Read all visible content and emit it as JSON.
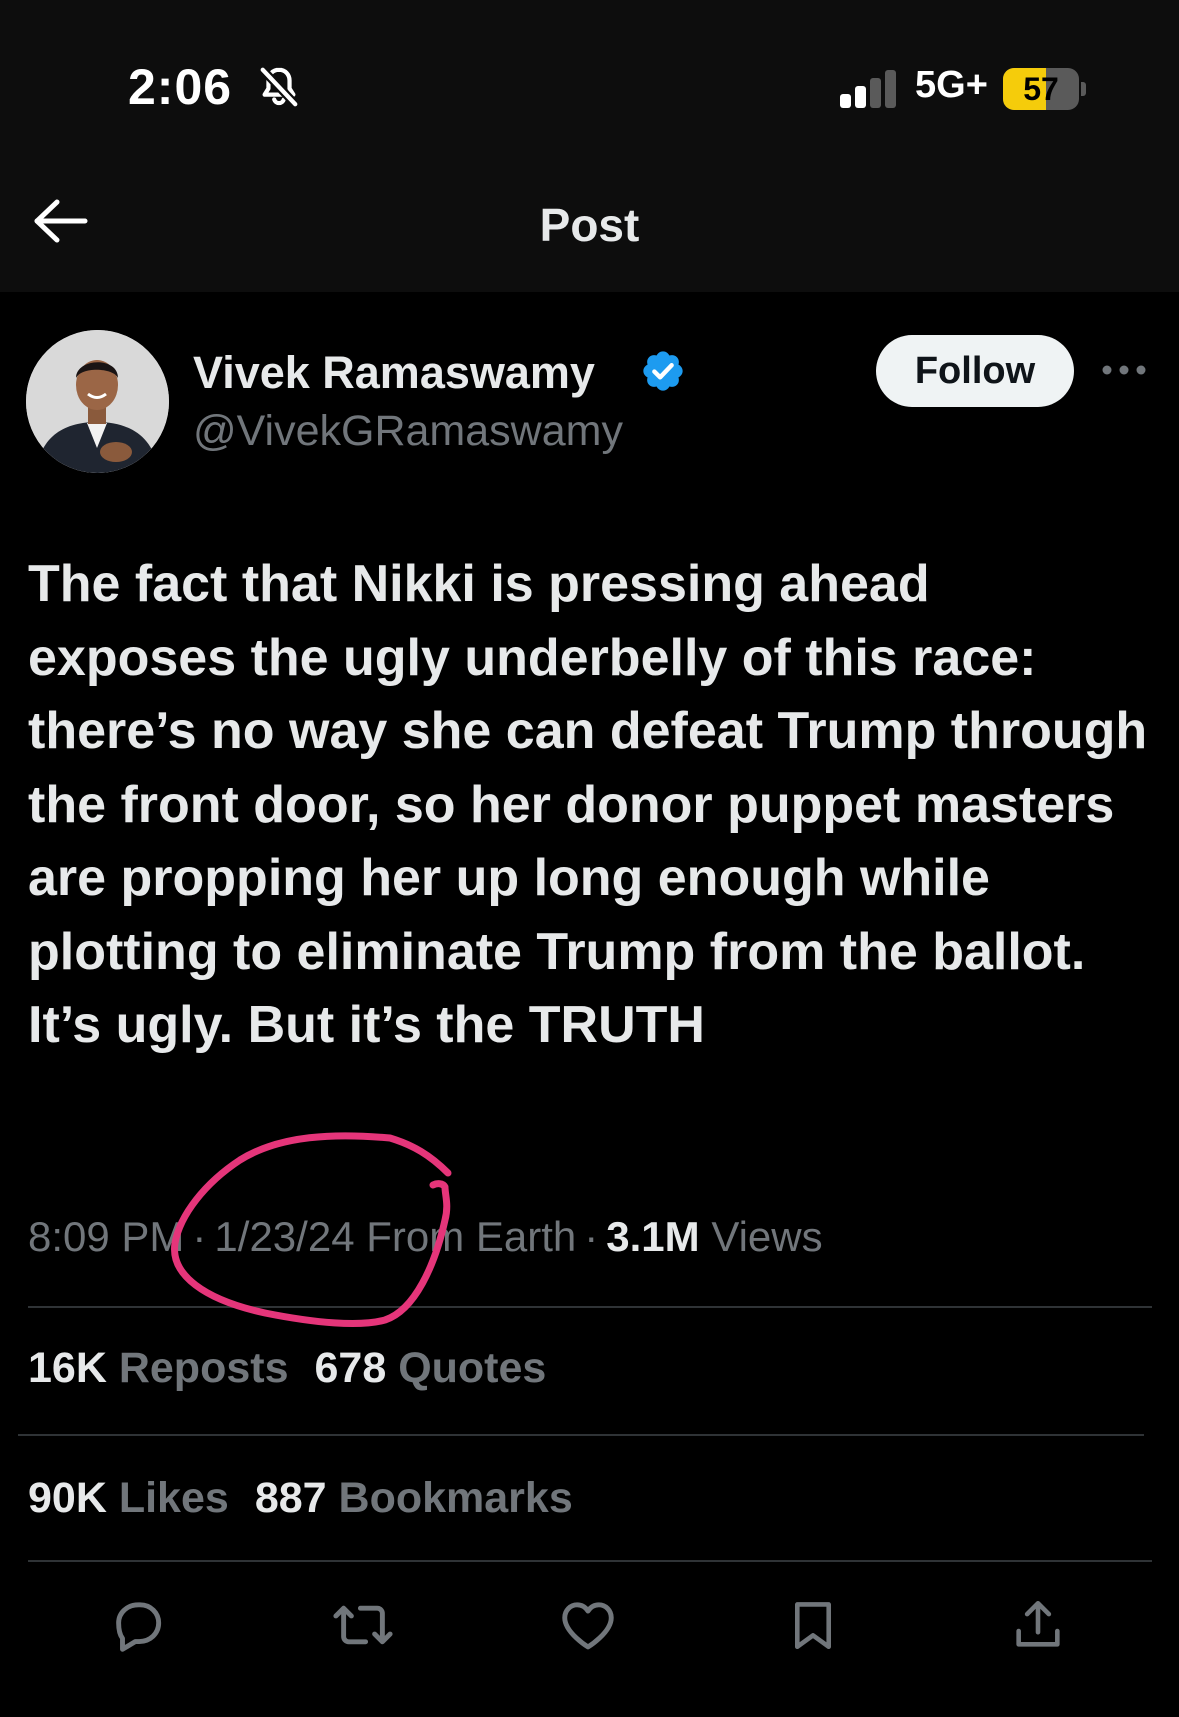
{
  "status_bar": {
    "time": "2:06",
    "silent_icon": "bell-slash-icon",
    "signal_icon": "cellular-signal-icon",
    "network": "5G+",
    "battery_percent": "57",
    "battery_level": 0.57,
    "battery_color": "#f5cc0b"
  },
  "nav": {
    "back_icon": "arrow-left-icon",
    "title": "Post"
  },
  "post": {
    "author": {
      "name": "Vivek Ramaswamy",
      "handle": "@VivekGRamaswamy",
      "verified_icon": "verified-badge-icon",
      "verified_color": "#1d9bf0"
    },
    "follow_label": "Follow",
    "more_icon": "more-horizontal-icon",
    "text": "The fact that Nikki is pressing ahead exposes the ugly underbelly of this race: there’s no way she can defeat Trump through the front door, so her donor puppet masters are propping her up long enough while plotting to eliminate Trump from the ballot. It’s ugly. But it’s the TRUTH",
    "time": "8:09 PM",
    "date": "1/23/24",
    "location": "From Earth",
    "separator": "·",
    "views_count": "3.1M",
    "views_label": "Views",
    "reposts_count": "16K",
    "reposts_label": "Reposts",
    "quotes_count": "678",
    "quotes_label": "Quotes",
    "likes_count": "90K",
    "likes_label": "Likes",
    "bookmarks_count": "887",
    "bookmarks_label": "Bookmarks"
  },
  "actions": [
    {
      "icon": "reply-icon"
    },
    {
      "icon": "repost-icon"
    },
    {
      "icon": "like-icon"
    },
    {
      "icon": "bookmark-icon"
    },
    {
      "icon": "share-icon"
    }
  ],
  "annotation": {
    "shape": "hand-drawn-circle",
    "color": "#e5357a"
  }
}
